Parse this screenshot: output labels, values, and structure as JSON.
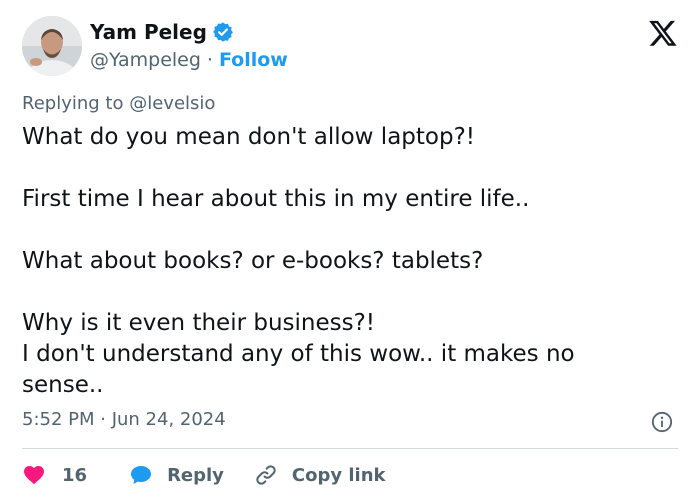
{
  "author": {
    "name": "Yam Peleg",
    "handle": "@Yampeleg",
    "separator": "·",
    "follow_label": "Follow"
  },
  "reply": {
    "prefix": "Replying to",
    "mention": "@levelsio"
  },
  "tweet": {
    "text": "What do you mean don't allow laptop?!\n\nFirst time I hear about this in my entire life..\n\nWhat about books? or e-books? tablets?\n\nWhy is it even their business?!\nI don't understand any of this wow.. it makes no\nsense.."
  },
  "meta": {
    "timestamp": "5:52 PM · Jun 24, 2024"
  },
  "actions": {
    "like_count": "16",
    "reply_label": "Reply",
    "copy_label": "Copy link"
  },
  "colors": {
    "accent": "#1d9bf0",
    "like": "#f91880",
    "text": "#0f1419",
    "muted": "#536471"
  },
  "icons": {
    "verified": "verified-badge-icon",
    "logo": "x-logo-icon",
    "info": "info-icon",
    "like": "heart-icon",
    "reply": "reply-bubble-icon",
    "copy": "link-icon"
  }
}
